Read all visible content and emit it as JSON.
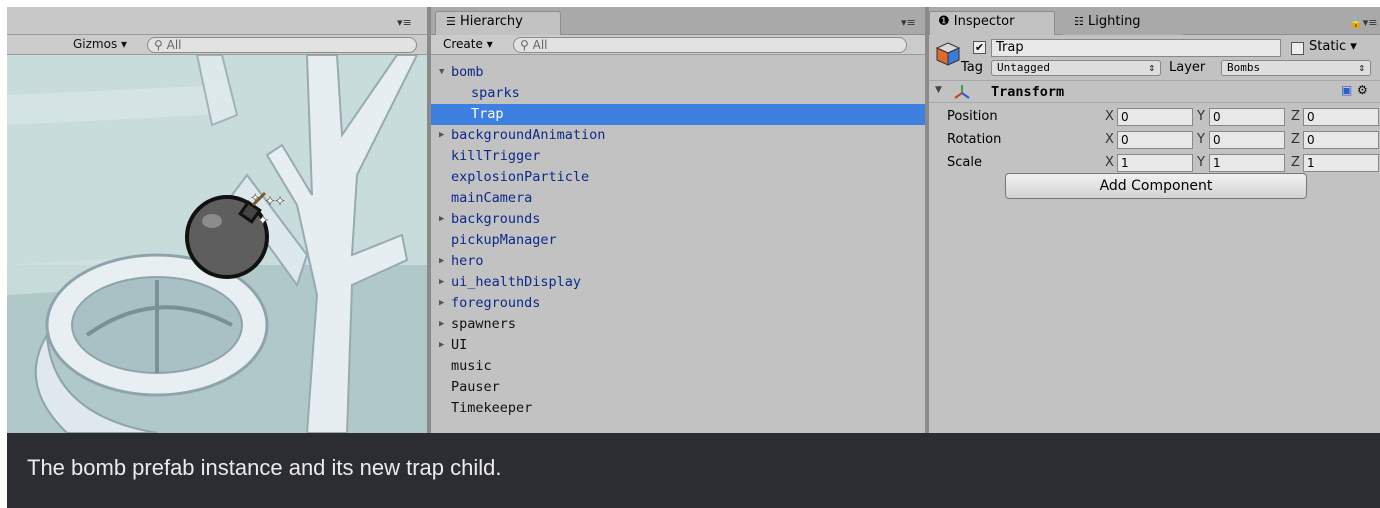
{
  "scene": {
    "menu_glyph": "▾≡",
    "gizmos_label": "Gizmos",
    "search_placeholder": "All"
  },
  "hierarchy": {
    "tab_label": "Hierarchy",
    "menu_glyph": "▾≡",
    "create_label": "Create",
    "search_placeholder": "All",
    "items": [
      {
        "label": "bomb",
        "expanded": true,
        "arrow": "▼"
      },
      {
        "label": "sparks",
        "indent": true
      },
      {
        "label": "Trap",
        "indent": true,
        "selected": true
      },
      {
        "label": "backgroundAnimation",
        "arrow": "▶"
      },
      {
        "label": "killTrigger"
      },
      {
        "label": "explosionParticle"
      },
      {
        "label": "mainCamera"
      },
      {
        "label": "backgrounds",
        "arrow": "▶"
      },
      {
        "label": "pickupManager"
      },
      {
        "label": "hero",
        "arrow": "▶"
      },
      {
        "label": "ui_healthDisplay",
        "arrow": "▶"
      },
      {
        "label": "foregrounds",
        "arrow": "▶"
      },
      {
        "label": "spawners",
        "arrow": "▶",
        "black": true
      },
      {
        "label": "UI",
        "arrow": "▶",
        "black": true
      },
      {
        "label": "music",
        "black": true
      },
      {
        "label": "Pauser",
        "black": true
      },
      {
        "label": "Timekeeper",
        "black": true
      }
    ]
  },
  "inspector": {
    "tab_label": "Inspector",
    "tab2_label": "Lighting",
    "object_name": "Trap",
    "static_label": "Static",
    "tag_label": "Tag",
    "tag_value": "Untagged",
    "layer_label": "Layer",
    "layer_value": "Bombs",
    "component_title": "Transform",
    "rows": [
      {
        "label": "Position",
        "x": "0",
        "y": "0",
        "z": "0"
      },
      {
        "label": "Rotation",
        "x": "0",
        "y": "0",
        "z": "0"
      },
      {
        "label": "Scale",
        "x": "1",
        "y": "1",
        "z": "1"
      }
    ],
    "axis_labels": {
      "x": "X",
      "y": "Y",
      "z": "Z"
    },
    "add_component_label": "Add Component"
  },
  "caption": "The bomb prefab instance and its new trap child."
}
